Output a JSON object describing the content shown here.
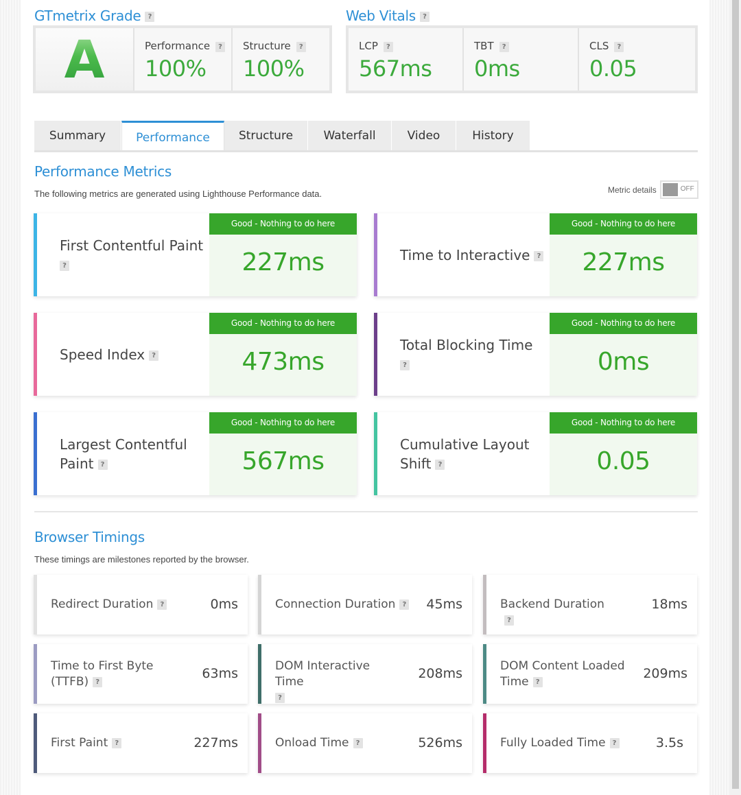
{
  "grade": {
    "title": "GTmetrix Grade",
    "letter": "A",
    "performance_label": "Performance",
    "performance_value": "100%",
    "structure_label": "Structure",
    "structure_value": "100%"
  },
  "vitals": {
    "title": "Web Vitals",
    "lcp_label": "LCP",
    "lcp_value": "567ms",
    "tbt_label": "TBT",
    "tbt_value": "0ms",
    "cls_label": "CLS",
    "cls_value": "0.05"
  },
  "help_mark": "?",
  "tabs": [
    {
      "label": "Summary",
      "active": false
    },
    {
      "label": "Performance",
      "active": true
    },
    {
      "label": "Structure",
      "active": false
    },
    {
      "label": "Waterfall",
      "active": false
    },
    {
      "label": "Video",
      "active": false
    },
    {
      "label": "History",
      "active": false
    }
  ],
  "performance": {
    "title": "Performance Metrics",
    "description": "The following metrics are generated using Lighthouse Performance data.",
    "metric_details_label": "Metric details",
    "toggle_state": "OFF",
    "status_text": "Good - Nothing to do here",
    "metrics": [
      {
        "name": "First Contentful Paint",
        "value": "227ms",
        "color": "#3cb4e6"
      },
      {
        "name": "Time to Interactive",
        "value": "227ms",
        "color": "#a87bd0"
      },
      {
        "name": "Speed Index",
        "value": "473ms",
        "color": "#e8699a"
      },
      {
        "name": "Total Blocking Time",
        "value": "0ms",
        "color": "#6c3f8a"
      },
      {
        "name": "Largest Contentful Paint",
        "value": "567ms",
        "color": "#3a6fd0"
      },
      {
        "name": "Cumulative Layout Shift",
        "value": "0.05",
        "color": "#44c4a1"
      }
    ]
  },
  "browser": {
    "title": "Browser Timings",
    "description": "These timings are milestones reported by the browser.",
    "timings": [
      {
        "name": "Redirect Duration",
        "value": "0ms",
        "color": "#e2e2e2"
      },
      {
        "name": "Connection Duration",
        "value": "45ms",
        "color": "#d4d4d4"
      },
      {
        "name": "Backend Duration",
        "value": "18ms",
        "color": "#c2bcbe"
      },
      {
        "name": "Time to First Byte (TTFB)",
        "value": "63ms",
        "color": "#9b9bc2"
      },
      {
        "name": "DOM Interactive Time",
        "value": "208ms",
        "color": "#3f6e69"
      },
      {
        "name": "DOM Content Loaded Time",
        "value": "209ms",
        "color": "#4d8a85"
      },
      {
        "name": "First Paint",
        "value": "227ms",
        "color": "#4e5a7a"
      },
      {
        "name": "Onload Time",
        "value": "526ms",
        "color": "#a14d88"
      },
      {
        "name": "Fully Loaded Time",
        "value": "3.5s",
        "color": "#b52d6a"
      }
    ]
  }
}
